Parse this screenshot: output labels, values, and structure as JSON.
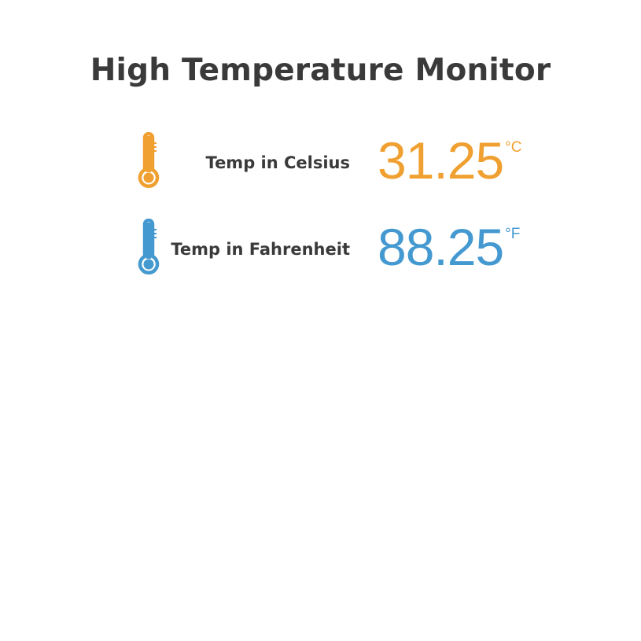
{
  "title": "High Temperature Monitor",
  "readings": [
    {
      "label": "Temp in Celsius",
      "value": "31.25",
      "unit": "°C",
      "icon": "thermometer-icon",
      "color": "#f0a030"
    },
    {
      "label": "Temp in Fahrenheit",
      "value": "88.25",
      "unit": "°F",
      "icon": "thermometer-icon",
      "color": "#4499d0"
    }
  ]
}
